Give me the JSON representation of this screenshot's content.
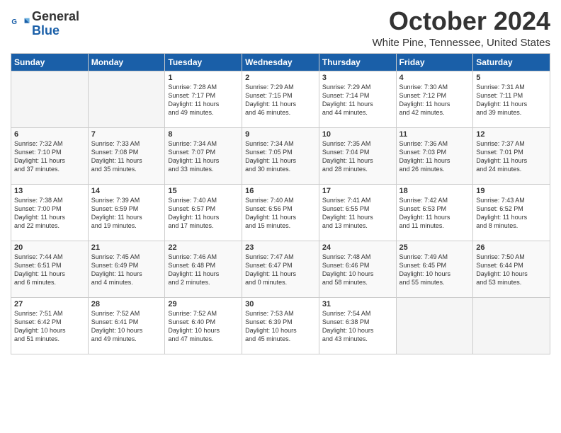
{
  "header": {
    "logo_line1": "General",
    "logo_line2": "Blue",
    "month_title": "October 2024",
    "location": "White Pine, Tennessee, United States"
  },
  "days_of_week": [
    "Sunday",
    "Monday",
    "Tuesday",
    "Wednesday",
    "Thursday",
    "Friday",
    "Saturday"
  ],
  "weeks": [
    [
      {
        "day": "",
        "info": ""
      },
      {
        "day": "",
        "info": ""
      },
      {
        "day": "1",
        "info": "Sunrise: 7:28 AM\nSunset: 7:17 PM\nDaylight: 11 hours\nand 49 minutes."
      },
      {
        "day": "2",
        "info": "Sunrise: 7:29 AM\nSunset: 7:15 PM\nDaylight: 11 hours\nand 46 minutes."
      },
      {
        "day": "3",
        "info": "Sunrise: 7:29 AM\nSunset: 7:14 PM\nDaylight: 11 hours\nand 44 minutes."
      },
      {
        "day": "4",
        "info": "Sunrise: 7:30 AM\nSunset: 7:12 PM\nDaylight: 11 hours\nand 42 minutes."
      },
      {
        "day": "5",
        "info": "Sunrise: 7:31 AM\nSunset: 7:11 PM\nDaylight: 11 hours\nand 39 minutes."
      }
    ],
    [
      {
        "day": "6",
        "info": "Sunrise: 7:32 AM\nSunset: 7:10 PM\nDaylight: 11 hours\nand 37 minutes."
      },
      {
        "day": "7",
        "info": "Sunrise: 7:33 AM\nSunset: 7:08 PM\nDaylight: 11 hours\nand 35 minutes."
      },
      {
        "day": "8",
        "info": "Sunrise: 7:34 AM\nSunset: 7:07 PM\nDaylight: 11 hours\nand 33 minutes."
      },
      {
        "day": "9",
        "info": "Sunrise: 7:34 AM\nSunset: 7:05 PM\nDaylight: 11 hours\nand 30 minutes."
      },
      {
        "day": "10",
        "info": "Sunrise: 7:35 AM\nSunset: 7:04 PM\nDaylight: 11 hours\nand 28 minutes."
      },
      {
        "day": "11",
        "info": "Sunrise: 7:36 AM\nSunset: 7:03 PM\nDaylight: 11 hours\nand 26 minutes."
      },
      {
        "day": "12",
        "info": "Sunrise: 7:37 AM\nSunset: 7:01 PM\nDaylight: 11 hours\nand 24 minutes."
      }
    ],
    [
      {
        "day": "13",
        "info": "Sunrise: 7:38 AM\nSunset: 7:00 PM\nDaylight: 11 hours\nand 22 minutes."
      },
      {
        "day": "14",
        "info": "Sunrise: 7:39 AM\nSunset: 6:59 PM\nDaylight: 11 hours\nand 19 minutes."
      },
      {
        "day": "15",
        "info": "Sunrise: 7:40 AM\nSunset: 6:57 PM\nDaylight: 11 hours\nand 17 minutes."
      },
      {
        "day": "16",
        "info": "Sunrise: 7:40 AM\nSunset: 6:56 PM\nDaylight: 11 hours\nand 15 minutes."
      },
      {
        "day": "17",
        "info": "Sunrise: 7:41 AM\nSunset: 6:55 PM\nDaylight: 11 hours\nand 13 minutes."
      },
      {
        "day": "18",
        "info": "Sunrise: 7:42 AM\nSunset: 6:53 PM\nDaylight: 11 hours\nand 11 minutes."
      },
      {
        "day": "19",
        "info": "Sunrise: 7:43 AM\nSunset: 6:52 PM\nDaylight: 11 hours\nand 8 minutes."
      }
    ],
    [
      {
        "day": "20",
        "info": "Sunrise: 7:44 AM\nSunset: 6:51 PM\nDaylight: 11 hours\nand 6 minutes."
      },
      {
        "day": "21",
        "info": "Sunrise: 7:45 AM\nSunset: 6:49 PM\nDaylight: 11 hours\nand 4 minutes."
      },
      {
        "day": "22",
        "info": "Sunrise: 7:46 AM\nSunset: 6:48 PM\nDaylight: 11 hours\nand 2 minutes."
      },
      {
        "day": "23",
        "info": "Sunrise: 7:47 AM\nSunset: 6:47 PM\nDaylight: 11 hours\nand 0 minutes."
      },
      {
        "day": "24",
        "info": "Sunrise: 7:48 AM\nSunset: 6:46 PM\nDaylight: 10 hours\nand 58 minutes."
      },
      {
        "day": "25",
        "info": "Sunrise: 7:49 AM\nSunset: 6:45 PM\nDaylight: 10 hours\nand 55 minutes."
      },
      {
        "day": "26",
        "info": "Sunrise: 7:50 AM\nSunset: 6:44 PM\nDaylight: 10 hours\nand 53 minutes."
      }
    ],
    [
      {
        "day": "27",
        "info": "Sunrise: 7:51 AM\nSunset: 6:42 PM\nDaylight: 10 hours\nand 51 minutes."
      },
      {
        "day": "28",
        "info": "Sunrise: 7:52 AM\nSunset: 6:41 PM\nDaylight: 10 hours\nand 49 minutes."
      },
      {
        "day": "29",
        "info": "Sunrise: 7:52 AM\nSunset: 6:40 PM\nDaylight: 10 hours\nand 47 minutes."
      },
      {
        "day": "30",
        "info": "Sunrise: 7:53 AM\nSunset: 6:39 PM\nDaylight: 10 hours\nand 45 minutes."
      },
      {
        "day": "31",
        "info": "Sunrise: 7:54 AM\nSunset: 6:38 PM\nDaylight: 10 hours\nand 43 minutes."
      },
      {
        "day": "",
        "info": ""
      },
      {
        "day": "",
        "info": ""
      }
    ]
  ]
}
